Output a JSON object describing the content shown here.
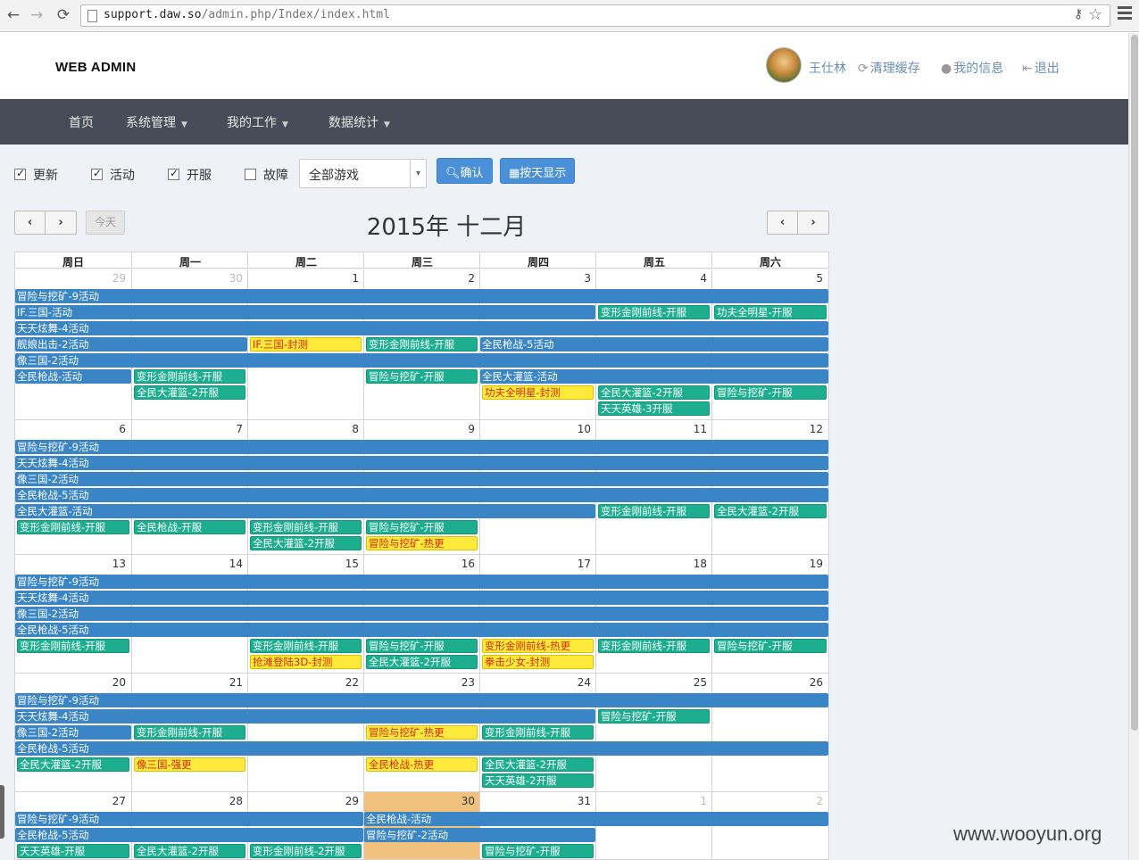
{
  "browser": {
    "url_host": "support.daw.so",
    "url_path": "/admin.php/Index/index.html",
    "back": "←",
    "forward": "→",
    "reload": "⟳"
  },
  "header": {
    "brand": "WEB ADMIN",
    "user_name": "王仕林",
    "clear_cache": "清理缓存",
    "my_info": "我的信息",
    "logout": "退出"
  },
  "nav": {
    "home": "首页",
    "system": "系统管理",
    "work": "我的工作",
    "stats": "数据统计"
  },
  "filters": {
    "update": "更新",
    "activity": "活动",
    "open_server": "开服",
    "fault": "故障",
    "checked": {
      "update": true,
      "activity": true,
      "open_server": true,
      "fault": false
    },
    "game_select": "全部游戏",
    "confirm": "确认",
    "by_day": "按天显示"
  },
  "calendar": {
    "title": "2015年 十二月",
    "today": "今天",
    "prev": "‹",
    "next": "›",
    "weekdays": [
      "周日",
      "周一",
      "周二",
      "周三",
      "周四",
      "周五",
      "周六"
    ],
    "weeks": [
      {
        "days": [
          "29",
          "30",
          "1",
          "2",
          "3",
          "4",
          "5"
        ],
        "other": [
          true,
          true,
          false,
          false,
          false,
          false,
          false
        ],
        "events": [
          {
            "type": "act",
            "s": 0,
            "e": 6,
            "row": 0,
            "label": "冒险与挖矿-9活动"
          },
          {
            "type": "act",
            "s": 0,
            "e": 4,
            "row": 1,
            "label": "IF.三国-活动"
          },
          {
            "type": "open",
            "s": 5,
            "e": 5,
            "row": 1,
            "label": "变形金刚前线-开服"
          },
          {
            "type": "open",
            "s": 6,
            "e": 6,
            "row": 1,
            "label": "功夫全明星-开服"
          },
          {
            "type": "act",
            "s": 0,
            "e": 6,
            "row": 2,
            "label": "天天炫舞-4活动"
          },
          {
            "type": "act",
            "s": 0,
            "e": 1,
            "row": 3,
            "label": "舰娘出击-2活动"
          },
          {
            "type": "warn",
            "s": 2,
            "e": 2,
            "row": 3,
            "label": "IF.三国-封测"
          },
          {
            "type": "open",
            "s": 3,
            "e": 3,
            "row": 3,
            "label": "变形金刚前线-开服"
          },
          {
            "type": "act",
            "s": 4,
            "e": 6,
            "row": 3,
            "label": "全民枪战-5活动"
          },
          {
            "type": "act",
            "s": 0,
            "e": 6,
            "row": 4,
            "label": "像三国-2活动"
          },
          {
            "type": "act",
            "s": 0,
            "e": 0,
            "row": 5,
            "label": "全民枪战-活动"
          },
          {
            "type": "open",
            "s": 1,
            "e": 1,
            "row": 5,
            "label": "变形金刚前线-开服"
          },
          {
            "type": "open",
            "s": 3,
            "e": 3,
            "row": 5,
            "label": "冒险与挖矿-开服"
          },
          {
            "type": "act",
            "s": 4,
            "e": 6,
            "row": 5,
            "label": "全民大灌篮-活动"
          },
          {
            "type": "open",
            "s": 1,
            "e": 1,
            "row": 6,
            "label": "全民大灌篮-2开服"
          },
          {
            "type": "warn",
            "s": 4,
            "e": 4,
            "row": 6,
            "label": "功夫全明星-封测"
          },
          {
            "type": "open",
            "s": 5,
            "e": 5,
            "row": 6,
            "label": "全民大灌篮-2开服"
          },
          {
            "type": "open",
            "s": 6,
            "e": 6,
            "row": 6,
            "label": "冒险与挖矿-开服"
          },
          {
            "type": "open",
            "s": 5,
            "e": 5,
            "row": 7,
            "label": "天天英雄-3开服"
          }
        ]
      },
      {
        "days": [
          "6",
          "7",
          "8",
          "9",
          "10",
          "11",
          "12"
        ],
        "other": [
          false,
          false,
          false,
          false,
          false,
          false,
          false
        ],
        "events": [
          {
            "type": "act",
            "s": 0,
            "e": 6,
            "row": 0,
            "label": "冒险与挖矿-9活动"
          },
          {
            "type": "act",
            "s": 0,
            "e": 6,
            "row": 1,
            "label": "天天炫舞-4活动"
          },
          {
            "type": "act",
            "s": 0,
            "e": 6,
            "row": 2,
            "label": "像三国-2活动"
          },
          {
            "type": "act",
            "s": 0,
            "e": 6,
            "row": 3,
            "label": "全民枪战-5活动"
          },
          {
            "type": "act",
            "s": 0,
            "e": 4,
            "row": 4,
            "label": "全民大灌篮-活动"
          },
          {
            "type": "open",
            "s": 5,
            "e": 5,
            "row": 4,
            "label": "变形金刚前线-开服"
          },
          {
            "type": "open",
            "s": 6,
            "e": 6,
            "row": 4,
            "label": "全民大灌篮-2开服"
          },
          {
            "type": "open",
            "s": 0,
            "e": 0,
            "row": 5,
            "label": "变形金刚前线-开服"
          },
          {
            "type": "open",
            "s": 1,
            "e": 1,
            "row": 5,
            "label": "全民枪战-开服"
          },
          {
            "type": "open",
            "s": 2,
            "e": 2,
            "row": 5,
            "label": "变形金刚前线-开服"
          },
          {
            "type": "open",
            "s": 3,
            "e": 3,
            "row": 5,
            "label": "冒险与挖矿-开服"
          },
          {
            "type": "open",
            "s": 2,
            "e": 2,
            "row": 6,
            "label": "全民大灌篮-2开服"
          },
          {
            "type": "warn",
            "s": 3,
            "e": 3,
            "row": 6,
            "label": "冒险与挖矿-热更"
          }
        ]
      },
      {
        "days": [
          "13",
          "14",
          "15",
          "16",
          "17",
          "18",
          "19"
        ],
        "other": [
          false,
          false,
          false,
          false,
          false,
          false,
          false
        ],
        "events": [
          {
            "type": "act",
            "s": 0,
            "e": 6,
            "row": 0,
            "label": "冒险与挖矿-9活动"
          },
          {
            "type": "act",
            "s": 0,
            "e": 6,
            "row": 1,
            "label": "天天炫舞-4活动"
          },
          {
            "type": "act",
            "s": 0,
            "e": 6,
            "row": 2,
            "label": "像三国-2活动"
          },
          {
            "type": "act",
            "s": 0,
            "e": 6,
            "row": 3,
            "label": "全民枪战-5活动"
          },
          {
            "type": "open",
            "s": 0,
            "e": 0,
            "row": 4,
            "label": "变形金刚前线-开服"
          },
          {
            "type": "open",
            "s": 2,
            "e": 2,
            "row": 4,
            "label": "变形金刚前线-开服"
          },
          {
            "type": "open",
            "s": 3,
            "e": 3,
            "row": 4,
            "label": "冒险与挖矿-开服"
          },
          {
            "type": "warn",
            "s": 4,
            "e": 4,
            "row": 4,
            "label": "变形金刚前线-热更"
          },
          {
            "type": "open",
            "s": 5,
            "e": 5,
            "row": 4,
            "label": "变形金刚前线-开服"
          },
          {
            "type": "open",
            "s": 6,
            "e": 6,
            "row": 4,
            "label": "冒险与挖矿-开服"
          },
          {
            "type": "warn",
            "s": 2,
            "e": 2,
            "row": 5,
            "label": "抢滩登陆3D-封测"
          },
          {
            "type": "open",
            "s": 3,
            "e": 3,
            "row": 5,
            "label": "全民大灌篮-2开服"
          },
          {
            "type": "warn",
            "s": 4,
            "e": 4,
            "row": 5,
            "label": "拳击少女-封测"
          }
        ]
      },
      {
        "days": [
          "20",
          "21",
          "22",
          "23",
          "24",
          "25",
          "26"
        ],
        "other": [
          false,
          false,
          false,
          false,
          false,
          false,
          false
        ],
        "events": [
          {
            "type": "act",
            "s": 0,
            "e": 6,
            "row": 0,
            "label": "冒险与挖矿-9活动"
          },
          {
            "type": "act",
            "s": 0,
            "e": 4,
            "row": 1,
            "label": "天天炫舞-4活动"
          },
          {
            "type": "open",
            "s": 5,
            "e": 5,
            "row": 1,
            "label": "冒险与挖矿-开服"
          },
          {
            "type": "act",
            "s": 0,
            "e": 0,
            "row": 2,
            "label": "像三国-2活动"
          },
          {
            "type": "open",
            "s": 1,
            "e": 1,
            "row": 2,
            "label": "变形金刚前线-开服"
          },
          {
            "type": "warn",
            "s": 3,
            "e": 3,
            "row": 2,
            "label": "冒险与挖矿-热更"
          },
          {
            "type": "open",
            "s": 4,
            "e": 4,
            "row": 2,
            "label": "变形金刚前线-开服"
          },
          {
            "type": "act",
            "s": 0,
            "e": 6,
            "row": 3,
            "label": "全民枪战-5活动"
          },
          {
            "type": "open",
            "s": 0,
            "e": 0,
            "row": 4,
            "label": "全民大灌篮-2开服"
          },
          {
            "type": "warn",
            "s": 1,
            "e": 1,
            "row": 4,
            "label": "像三国-强更"
          },
          {
            "type": "warn",
            "s": 3,
            "e": 3,
            "row": 4,
            "label": "全民枪战-热更"
          },
          {
            "type": "open",
            "s": 4,
            "e": 4,
            "row": 4,
            "label": "全民大灌篮-2开服"
          },
          {
            "type": "open",
            "s": 4,
            "e": 4,
            "row": 5,
            "label": "天天英雄-2开服"
          }
        ]
      },
      {
        "days": [
          "27",
          "28",
          "29",
          "30",
          "31",
          "1",
          "2"
        ],
        "other": [
          false,
          false,
          false,
          false,
          false,
          true,
          true
        ],
        "today_col": 3,
        "events": [
          {
            "type": "act",
            "s": 0,
            "e": 2,
            "row": 0,
            "label": "冒险与挖矿-9活动"
          },
          {
            "type": "act",
            "s": 3,
            "e": 6,
            "row": 0,
            "label": "全民枪战-活动"
          },
          {
            "type": "act",
            "s": 0,
            "e": 2,
            "row": 1,
            "label": "全民枪战-5活动"
          },
          {
            "type": "act",
            "s": 3,
            "e": 4,
            "row": 1,
            "label": "冒险与挖矿-2活动"
          },
          {
            "type": "open",
            "s": 0,
            "e": 0,
            "row": 2,
            "label": "天天英雄-开服"
          },
          {
            "type": "open",
            "s": 1,
            "e": 1,
            "row": 2,
            "label": "全民大灌篮-2开服"
          },
          {
            "type": "open",
            "s": 2,
            "e": 2,
            "row": 2,
            "label": "变形金刚前线-2开服"
          },
          {
            "type": "open",
            "s": 4,
            "e": 4,
            "row": 2,
            "label": "冒险与挖矿-开服"
          }
        ]
      }
    ]
  },
  "watermark": "www.wooyun.org"
}
